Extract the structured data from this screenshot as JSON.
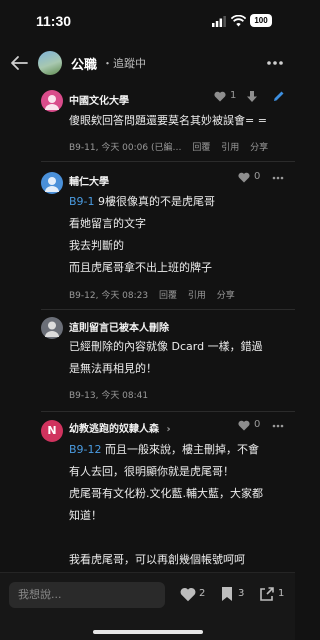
{
  "status_bar": {
    "time": "11:30",
    "battery": "100"
  },
  "header": {
    "board_name": "公職",
    "follow_label": "・追蹤中"
  },
  "comments": [
    {
      "author": "中國文化大學",
      "avatar_color": "#d94c8b",
      "likes": "1",
      "body_lines": [
        "傻眼欸回答問題還要莫名其妙被誤會= ="
      ],
      "ref": "",
      "meta": {
        "floor_time": "B9-11, 今天 00:06 (已編…",
        "reply": "回覆",
        "quote": "引用",
        "share": "分享"
      }
    },
    {
      "author": "輔仁大學",
      "avatar_color": "#4a90d9",
      "likes": "0",
      "ref": "B9-1",
      "body_lines": [
        " 9樓很像真的不是虎尾哥",
        "看她留言的文字",
        "我去判斷的",
        "而且虎尾哥拿不出上班的牌子"
      ],
      "meta": {
        "floor_time": "B9-12, 今天 08:23",
        "reply": "回覆",
        "quote": "引用",
        "share": "分享"
      }
    },
    {
      "author": "這則留言已被本人刪除",
      "avatar_color": "#6b6f78",
      "ref": "",
      "body_lines": [
        "已經刪除的內容就像 Dcard 一樣，錯過",
        "是無法再相見的！"
      ],
      "meta": {
        "floor_time": "B9-13, 今天 08:41"
      }
    },
    {
      "author": "幼教逃跑的奴隸人森",
      "author_suffix": "›",
      "avatar_color": "#d0335e",
      "avatar_letter": "N",
      "likes": "0",
      "ref": "B9-12",
      "body_lines": [
        " 而且一般來說，樓主刪掉，不會",
        "有人去回，很明顯你就是虎尾哥！",
        "虎尾哥有文化粉.文化藍.輔大藍，大家都",
        "知道！",
        "",
        "我看虎尾哥，可以再創幾個帳號呵呵"
      ]
    }
  ],
  "bottom_bar": {
    "placeholder": "我想說...",
    "like_count": "2",
    "save_count": "3",
    "share_count": "1"
  }
}
